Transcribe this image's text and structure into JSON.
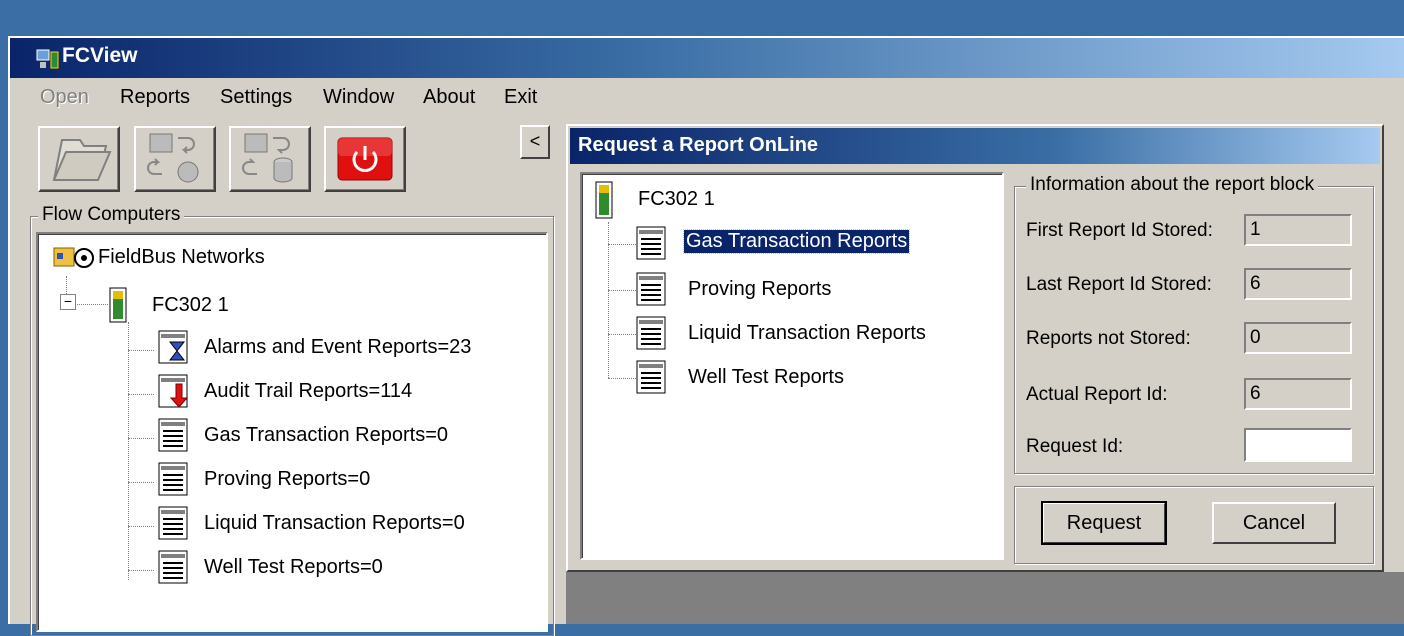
{
  "app": {
    "title": "FCView"
  },
  "menu": {
    "items": [
      "Open",
      "Reports",
      "Settings",
      "Window",
      "About",
      "Exit"
    ],
    "disabled_index": 0
  },
  "toolbar": {
    "buttons": [
      "open-folder-icon",
      "request-report-online-icon",
      "request-report-database-icon",
      "power-icon"
    ],
    "collapse_label": "<"
  },
  "flow_computers": {
    "group_label": "Flow Computers",
    "root": "FieldBus Networks",
    "device": "FC302 1",
    "reports": [
      "Alarms and Event Reports=23",
      "Audit Trail Reports=114",
      "Gas Transaction Reports=0",
      "Proving Reports=0",
      "Liquid Transaction Reports=0",
      "Well Test Reports=0"
    ]
  },
  "dialog": {
    "title": "Request a Report OnLine",
    "device": "FC302 1",
    "reports": [
      "Gas Transaction Reports",
      "Proving Reports",
      "Liquid Transaction Reports",
      "Well Test Reports"
    ],
    "selected_index": 0,
    "info": {
      "group_label": "Information about the report block",
      "first_label": "First Report Id Stored:",
      "first_value": "1",
      "last_label": "Last Report Id Stored:",
      "last_value": "6",
      "not_stored_label": "Reports not Stored:",
      "not_stored_value": "0",
      "actual_label": "Actual Report Id:",
      "actual_value": "6",
      "request_label": "Request Id:",
      "request_value": ""
    },
    "buttons": {
      "request": "Request",
      "cancel": "Cancel"
    }
  },
  "colors": {
    "titlebar": "#0a246a",
    "desktop": "#3a6ea5",
    "face": "#d4d0c8",
    "power": "#e01010"
  }
}
